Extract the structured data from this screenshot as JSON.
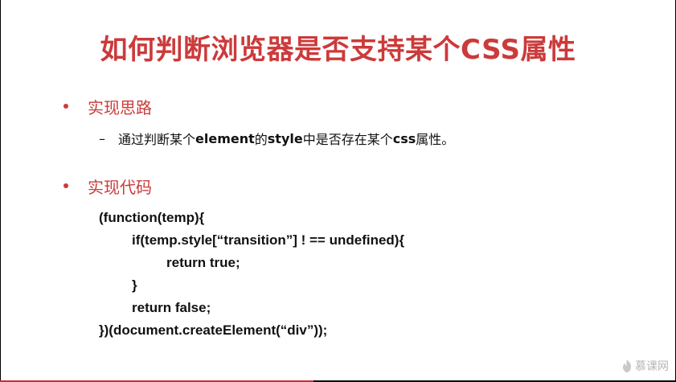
{
  "slide": {
    "title": "如何判断浏览器是否支持某个CSS属性",
    "bullets": [
      {
        "label": "实现思路"
      },
      {
        "label": "实现代码"
      }
    ],
    "sub_item": {
      "dash": "–",
      "part1": "通过判断某个",
      "part2": "element",
      "part3": "的",
      "part4": "style",
      "part5": "中是否存在某个",
      "part6": "css",
      "part7": "属性。"
    },
    "code_lines": [
      "(function(temp){",
      "if(temp.style[“transition”] ! == undefined){",
      "return true;",
      "}",
      "return false;",
      "})(document.createElement(“div”));"
    ],
    "watermark": "慕课网"
  },
  "colors": {
    "accent": "#cc3a3a",
    "text": "#111111",
    "background": "#ffffff",
    "frame": "#000000"
  },
  "icons": {
    "watermark_logo": "flame-icon"
  }
}
